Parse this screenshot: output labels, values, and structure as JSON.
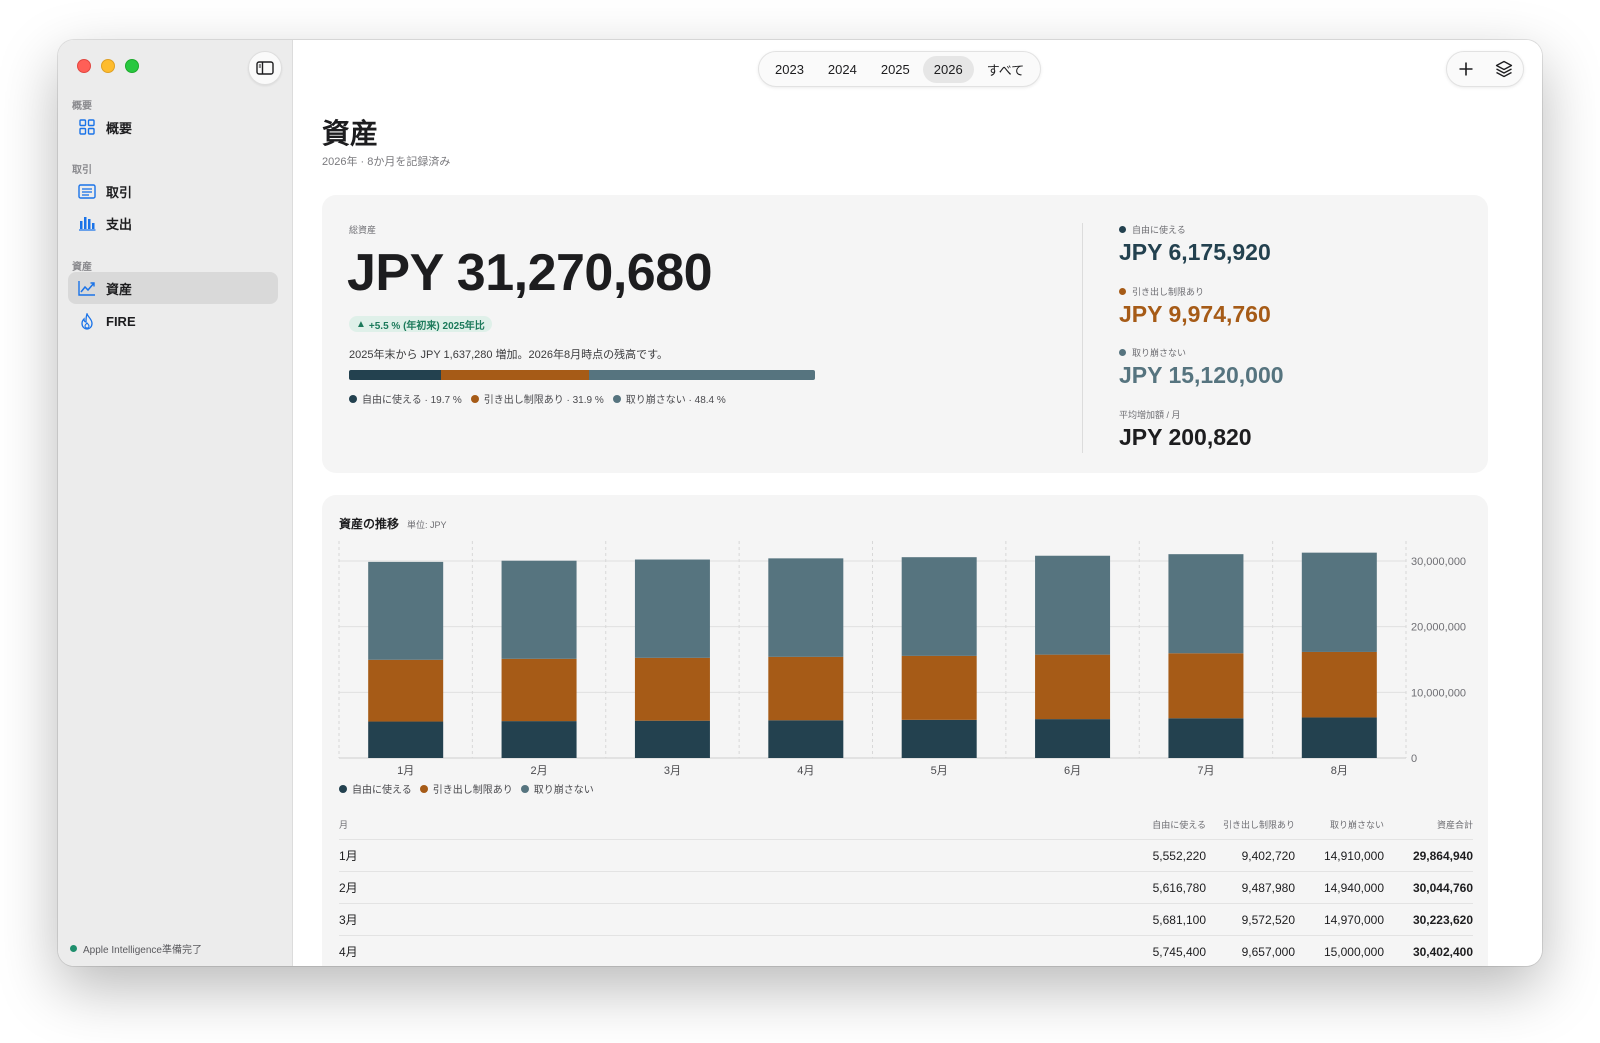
{
  "sidebar": {
    "sections": [
      {
        "label": "概要",
        "items": [
          {
            "label": "概要",
            "icon": "grid-icon"
          }
        ]
      },
      {
        "label": "取引",
        "items": [
          {
            "label": "取引",
            "icon": "list-icon"
          },
          {
            "label": "支出",
            "icon": "bar-chart-icon"
          }
        ]
      },
      {
        "label": "資産",
        "items": [
          {
            "label": "資産",
            "icon": "line-chart-icon",
            "active": true
          },
          {
            "label": "FIRE",
            "icon": "flame-icon"
          }
        ]
      }
    ],
    "status": "Apple Intelligence準備完了"
  },
  "toolbar": {
    "years": [
      "2023",
      "2024",
      "2025",
      "2026",
      "すべて"
    ],
    "selected_year": "2026"
  },
  "header": {
    "title": "資産",
    "subtitle": "2026年 · 8か月を記録済み"
  },
  "summary": {
    "total_label": "総資産",
    "total": "JPY 31,270,680",
    "badge": "+5.5 % (年初来) 2025年比",
    "description": "2025年末から JPY 1,637,280 増加。2026年8月時点の残高です。",
    "composition": [
      {
        "label": "自由に使える · 19.7 %",
        "percent": 19.7,
        "color": "#23414f"
      },
      {
        "label": "引き出し制限あり · 31.9 %",
        "percent": 31.9,
        "color": "#a65b17"
      },
      {
        "label": "取り崩さない · 48.4 %",
        "percent": 48.4,
        "color": "#56747f"
      }
    ],
    "breakdown": [
      {
        "label": "自由に使える",
        "value": "JPY 6,175,920",
        "color": "#23414f"
      },
      {
        "label": "引き出し制限あり",
        "value": "JPY 9,974,760",
        "color": "#a65b17"
      },
      {
        "label": "取り崩さない",
        "value": "JPY 15,120,000",
        "color": "#56747f"
      }
    ],
    "avg_label": "平均増加額 / 月",
    "avg_value": "JPY 200,820"
  },
  "trend": {
    "title": "資産の推移",
    "unit": "単位: JPY",
    "legend": [
      "自由に使える",
      "引き出し制限あり",
      "取り崩さない"
    ]
  },
  "chart_data": {
    "type": "bar",
    "stacked": true,
    "categories": [
      "1月",
      "2月",
      "3月",
      "4月",
      "5月",
      "6月",
      "7月",
      "8月"
    ],
    "series": [
      {
        "name": "自由に使える",
        "color": "#23414f",
        "values": [
          5552220,
          5616780,
          5681100,
          5745400,
          5810000,
          5920000,
          6050000,
          6175920
        ]
      },
      {
        "name": "引き出し制限あり",
        "color": "#a65b17",
        "values": [
          9402720,
          9487980,
          9572520,
          9657000,
          9740000,
          9820000,
          9900000,
          9974760
        ]
      },
      {
        "name": "取り崩さない",
        "color": "#56747f",
        "values": [
          14910000,
          14940000,
          14970000,
          15000000,
          15030000,
          15060000,
          15090000,
          15120000
        ]
      }
    ],
    "yticks": [
      0,
      10000000,
      20000000,
      30000000
    ],
    "ytick_labels": [
      "0",
      "10,000,000",
      "20,000,000",
      "30,000,000"
    ],
    "ylim": [
      0,
      30000000
    ],
    "grid": true,
    "legend_position": "bottom-left"
  },
  "table": {
    "headers": [
      "月",
      "自由に使える",
      "引き出し制限あり",
      "取り崩さない",
      "資産合計"
    ],
    "rows": [
      [
        "1月",
        "5,552,220",
        "9,402,720",
        "14,910,000",
        "29,864,940"
      ],
      [
        "2月",
        "5,616,780",
        "9,487,980",
        "14,940,000",
        "30,044,760"
      ],
      [
        "3月",
        "5,681,100",
        "9,572,520",
        "14,970,000",
        "30,223,620"
      ],
      [
        "4月",
        "5,745,400",
        "9,657,000",
        "15,000,000",
        "30,402,400"
      ]
    ]
  }
}
